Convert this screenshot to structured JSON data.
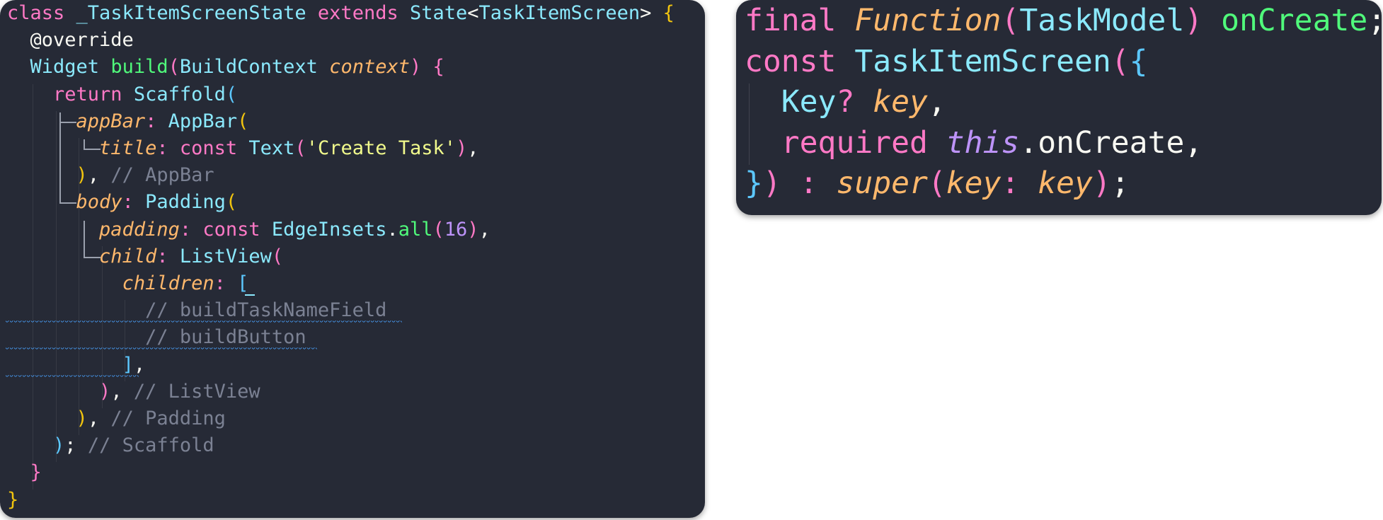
{
  "left_panel": {
    "lines": [
      [
        [
          "class ",
          "kw"
        ],
        [
          "_TaskItemScreenState ",
          "type"
        ],
        [
          "extends ",
          "kw"
        ],
        [
          "State",
          "type"
        ],
        [
          "<",
          "plain"
        ],
        [
          "TaskItemScreen",
          "type"
        ],
        [
          "> ",
          "plain"
        ],
        [
          "{",
          "b1"
        ]
      ],
      [
        [
          "  @override",
          "plain"
        ]
      ],
      [
        [
          "  ",
          "plain"
        ],
        [
          "Widget ",
          "type"
        ],
        [
          "build",
          "fn"
        ],
        [
          "(",
          "b2"
        ],
        [
          "BuildContext ",
          "type"
        ],
        [
          "context",
          "param"
        ],
        [
          ") ",
          "b2"
        ],
        [
          "{",
          "b2"
        ]
      ],
      [
        [
          "    ",
          "plain"
        ],
        [
          "return ",
          "kw"
        ],
        [
          "Scaffold",
          "type"
        ],
        [
          "(",
          "b3"
        ]
      ],
      [
        [
          "      ",
          "plain"
        ],
        [
          "appBar",
          "param"
        ],
        [
          ": ",
          "kw"
        ],
        [
          "AppBar",
          "type"
        ],
        [
          "(",
          "b1"
        ]
      ],
      [
        [
          "        ",
          "plain"
        ],
        [
          "title",
          "param"
        ],
        [
          ": ",
          "kw"
        ],
        [
          "const ",
          "kw"
        ],
        [
          "Text",
          "type"
        ],
        [
          "(",
          "b2"
        ],
        [
          "'Create Task'",
          "str"
        ],
        [
          ")",
          "b2"
        ],
        [
          ",",
          "plain"
        ]
      ],
      [
        [
          "      ",
          "plain"
        ],
        [
          ")",
          "b1"
        ],
        [
          ", ",
          "plain"
        ],
        [
          "// AppBar",
          "cmt"
        ]
      ],
      [
        [
          "      ",
          "plain"
        ],
        [
          "body",
          "param"
        ],
        [
          ": ",
          "kw"
        ],
        [
          "Padding",
          "type"
        ],
        [
          "(",
          "b1"
        ]
      ],
      [
        [
          "        ",
          "plain"
        ],
        [
          "padding",
          "param"
        ],
        [
          ": ",
          "kw"
        ],
        [
          "const ",
          "kw"
        ],
        [
          "EdgeInsets",
          "type"
        ],
        [
          ".",
          "plain"
        ],
        [
          "all",
          "fn"
        ],
        [
          "(",
          "b2"
        ],
        [
          "16",
          "num"
        ],
        [
          ")",
          "b2"
        ],
        [
          ",",
          "plain"
        ]
      ],
      [
        [
          "        ",
          "plain"
        ],
        [
          "child",
          "param"
        ],
        [
          ": ",
          "kw"
        ],
        [
          "ListView",
          "type"
        ],
        [
          "(",
          "b2"
        ]
      ],
      [
        [
          "          ",
          "plain"
        ],
        [
          "children",
          "param"
        ],
        [
          ": ",
          "kw"
        ],
        [
          "[",
          "b3"
        ]
      ],
      [
        [
          "            ",
          "plain"
        ],
        [
          "// buildTaskNameField",
          "cmt"
        ]
      ],
      [
        [
          "            ",
          "plain"
        ],
        [
          "// buildButton",
          "cmt"
        ]
      ],
      [
        [
          "          ",
          "plain"
        ],
        [
          "]",
          "b3"
        ],
        [
          ",",
          "plain"
        ]
      ],
      [
        [
          "        ",
          "plain"
        ],
        [
          ")",
          "b2"
        ],
        [
          ", ",
          "plain"
        ],
        [
          "// ListView",
          "cmt"
        ]
      ],
      [
        [
          "      ",
          "plain"
        ],
        [
          ")",
          "b1"
        ],
        [
          ", ",
          "plain"
        ],
        [
          "// Padding",
          "cmt"
        ]
      ],
      [
        [
          "    ",
          "plain"
        ],
        [
          ")",
          "b3"
        ],
        [
          "; ",
          "plain"
        ],
        [
          "// Scaffold",
          "cmt"
        ]
      ],
      [
        [
          "  ",
          "plain"
        ],
        [
          "}",
          "b2"
        ]
      ],
      [
        [
          "}",
          "b1"
        ]
      ]
    ]
  },
  "right_panel": {
    "lines": [
      [
        [
          "final ",
          "kw"
        ],
        [
          "Function",
          "param"
        ],
        [
          "(",
          "b2"
        ],
        [
          "TaskModel",
          "type"
        ],
        [
          ") ",
          "b2"
        ],
        [
          "onCreate",
          "fn"
        ],
        [
          ";",
          "plain"
        ]
      ],
      [
        [
          "const ",
          "kw"
        ],
        [
          "TaskItemScreen",
          "type"
        ],
        [
          "(",
          "b2"
        ],
        [
          "{",
          "b3"
        ]
      ],
      [
        [
          "  ",
          "plain"
        ],
        [
          "Key",
          "type"
        ],
        [
          "? ",
          "kw"
        ],
        [
          "key",
          "param"
        ],
        [
          ",",
          "plain"
        ]
      ],
      [
        [
          "  ",
          "plain"
        ],
        [
          "required ",
          "kw"
        ],
        [
          "this",
          "this"
        ],
        [
          ".",
          "plain"
        ],
        [
          "onCreate",
          "plain"
        ],
        [
          ",",
          "plain"
        ]
      ],
      [
        [
          "}",
          "b3"
        ],
        [
          ") ",
          "b2"
        ],
        [
          ": ",
          "kw"
        ],
        [
          "super",
          "param"
        ],
        [
          "(",
          "b2"
        ],
        [
          "key",
          "param"
        ],
        [
          ": ",
          "kw"
        ],
        [
          "key",
          "param"
        ],
        [
          ")",
          "b2"
        ],
        [
          ";",
          "plain"
        ]
      ]
    ]
  }
}
